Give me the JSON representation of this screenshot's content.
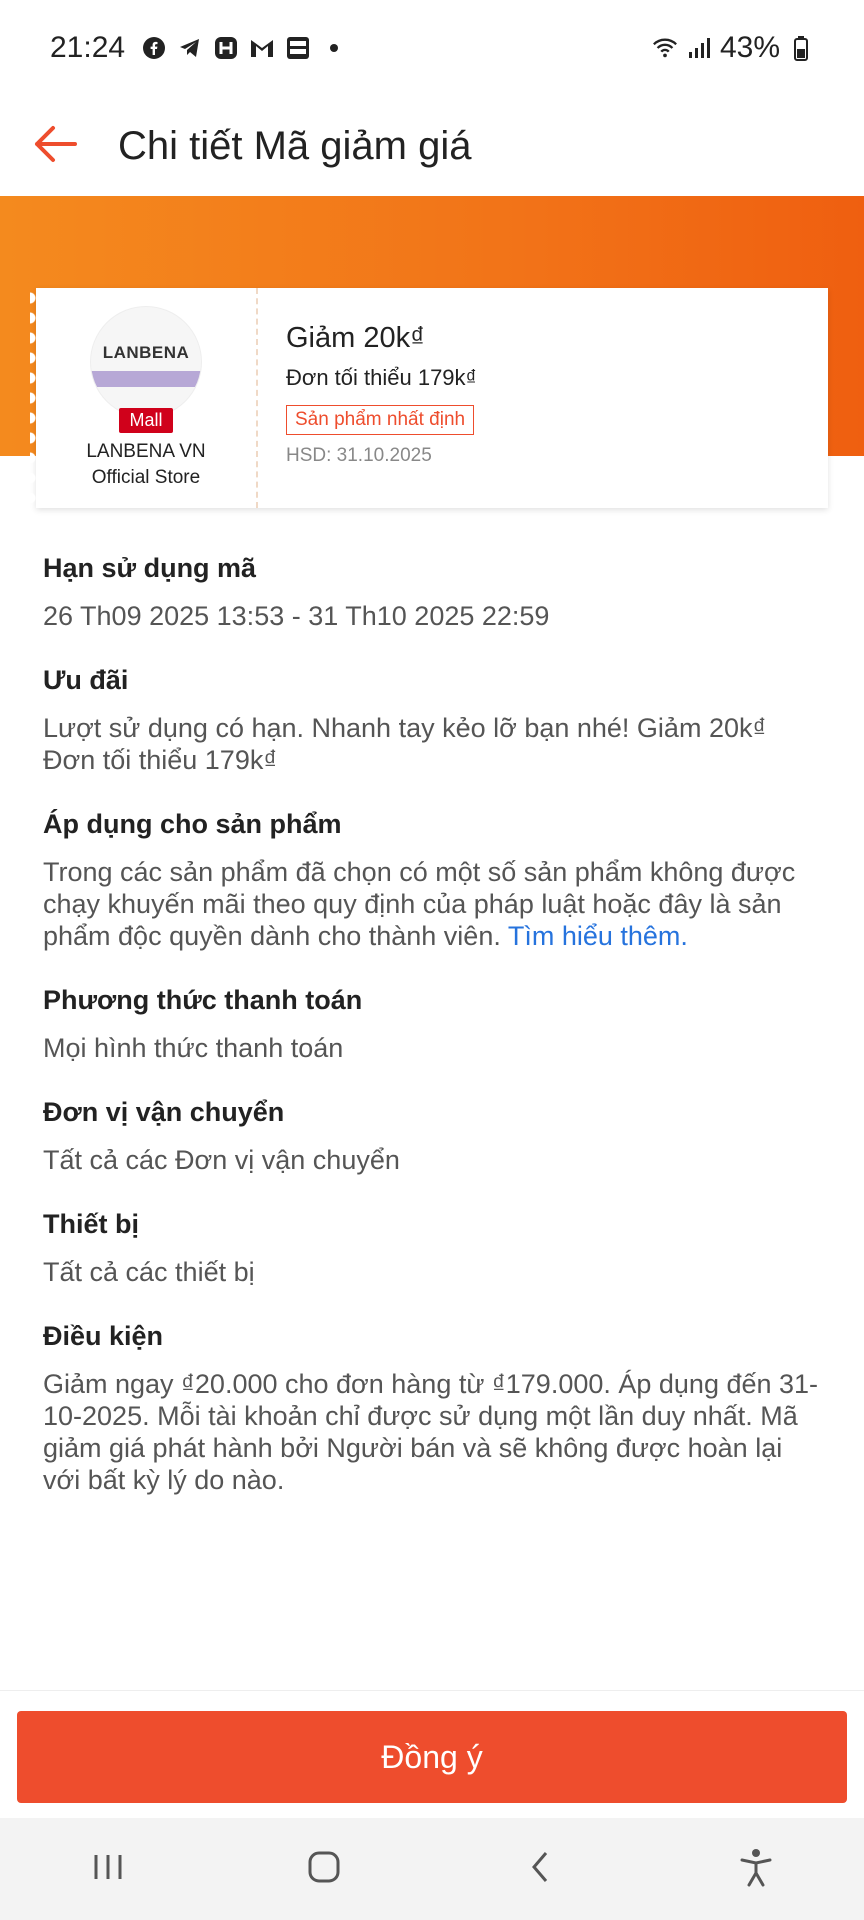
{
  "status_bar": {
    "time": "21:24",
    "battery": "43%",
    "icons": [
      "facebook-icon",
      "telegram-icon",
      "h-app-icon",
      "gmail-icon",
      "baomoi-icon",
      "dot-icon",
      "wifi-icon",
      "signal-icon",
      "battery-icon"
    ]
  },
  "header": {
    "title": "Chi tiết Mã giảm giá",
    "back_icon": "arrow-left-icon"
  },
  "voucher": {
    "shop_logo_text": "LANBENA",
    "mall_badge": "Mall",
    "shop_name_line1": "LANBENA VN",
    "shop_name_line2": "Official Store",
    "title": "Giảm 20k₫",
    "min_order": "Đơn tối thiểu 179k₫",
    "tag": "Sản phẩm nhất định",
    "expiry": "HSD: 31.10.2025"
  },
  "sections": {
    "validity": {
      "title": "Hạn sử dụng mã",
      "body": "26 Th09 2025 13:53 - 31 Th10 2025 22:59"
    },
    "offer": {
      "title": "Ưu đãi",
      "body": "Lượt sử dụng có hạn. Nhanh tay kẻo lỡ bạn nhé! Giảm 20k₫ Đơn tối thiểu 179k₫"
    },
    "products": {
      "title": "Áp dụng cho sản phẩm",
      "body": "Trong các sản phẩm đã chọn có một số sản phẩm không được chạy khuyến mãi theo quy định của pháp luật hoặc đây là sản phẩm độc quyền dành cho thành viên.",
      "link": "Tìm hiểu thêm."
    },
    "payment": {
      "title": "Phương thức thanh toán",
      "body": "Mọi hình thức thanh toán"
    },
    "shipping": {
      "title": "Đơn vị vận chuyển",
      "body": "Tất cả các Đơn vị vận chuyển"
    },
    "device": {
      "title": "Thiết bị",
      "body": "Tất cả các thiết bị"
    },
    "conditions": {
      "title": "Điều kiện",
      "body": "Giảm ngay ₫20.000 cho đơn hàng từ ₫179.000. Áp dụng đến 31-10-2025. Mỗi tài khoản chỉ được sử dụng một lần duy nhất. Mã giảm giá phát hành bởi Người bán và sẽ không được hoàn lại với bất kỳ lý do nào."
    }
  },
  "footer": {
    "agree_label": "Đồng ý"
  },
  "nav": {
    "icons": [
      "recent-apps-icon",
      "home-icon",
      "back-icon",
      "accessibility-icon"
    ]
  },
  "colors": {
    "accent": "#ee4d2d",
    "banner_start": "#f48a1e",
    "banner_end": "#ef5f10",
    "link": "#2673dd"
  }
}
